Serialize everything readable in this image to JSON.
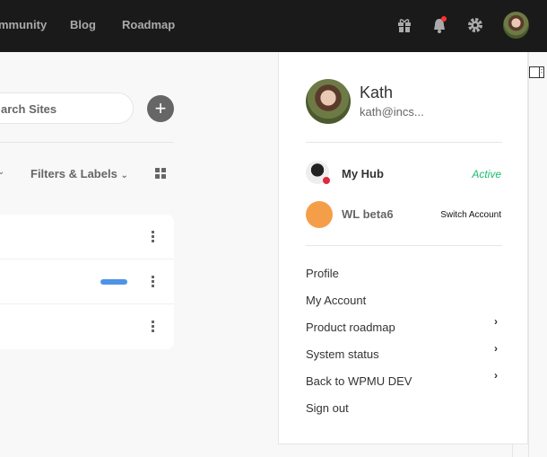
{
  "topbar": {
    "nav": [
      "mmunity",
      "Blog",
      "Roadmap"
    ],
    "icons": [
      "gift-icon",
      "bell-icon",
      "gear-icon",
      "user-avatar"
    ],
    "notification_color": "#ff3333"
  },
  "toolbar": {
    "search_placeholder": "arch Sites",
    "add_label": "+",
    "filters_label": "Filters & Labels"
  },
  "sites": {
    "rows": 3,
    "progress_color": "#4f93e6"
  },
  "account": {
    "name": "Kath",
    "email": "kath@incs...",
    "hubs": [
      {
        "name": "My Hub",
        "status": "Active",
        "status_color": "#1abc6f"
      },
      {
        "name": "WL beta6",
        "action": "Switch Account",
        "avatar_color": "#f59e4a"
      }
    ],
    "menu": [
      {
        "label": "Profile"
      },
      {
        "label": "My Account"
      },
      {
        "label": "Product roadmap",
        "submenu": true
      },
      {
        "label": "System status",
        "submenu": true
      },
      {
        "label": "Back to WPMU DEV",
        "submenu": true
      },
      {
        "label": "Sign out"
      }
    ]
  }
}
